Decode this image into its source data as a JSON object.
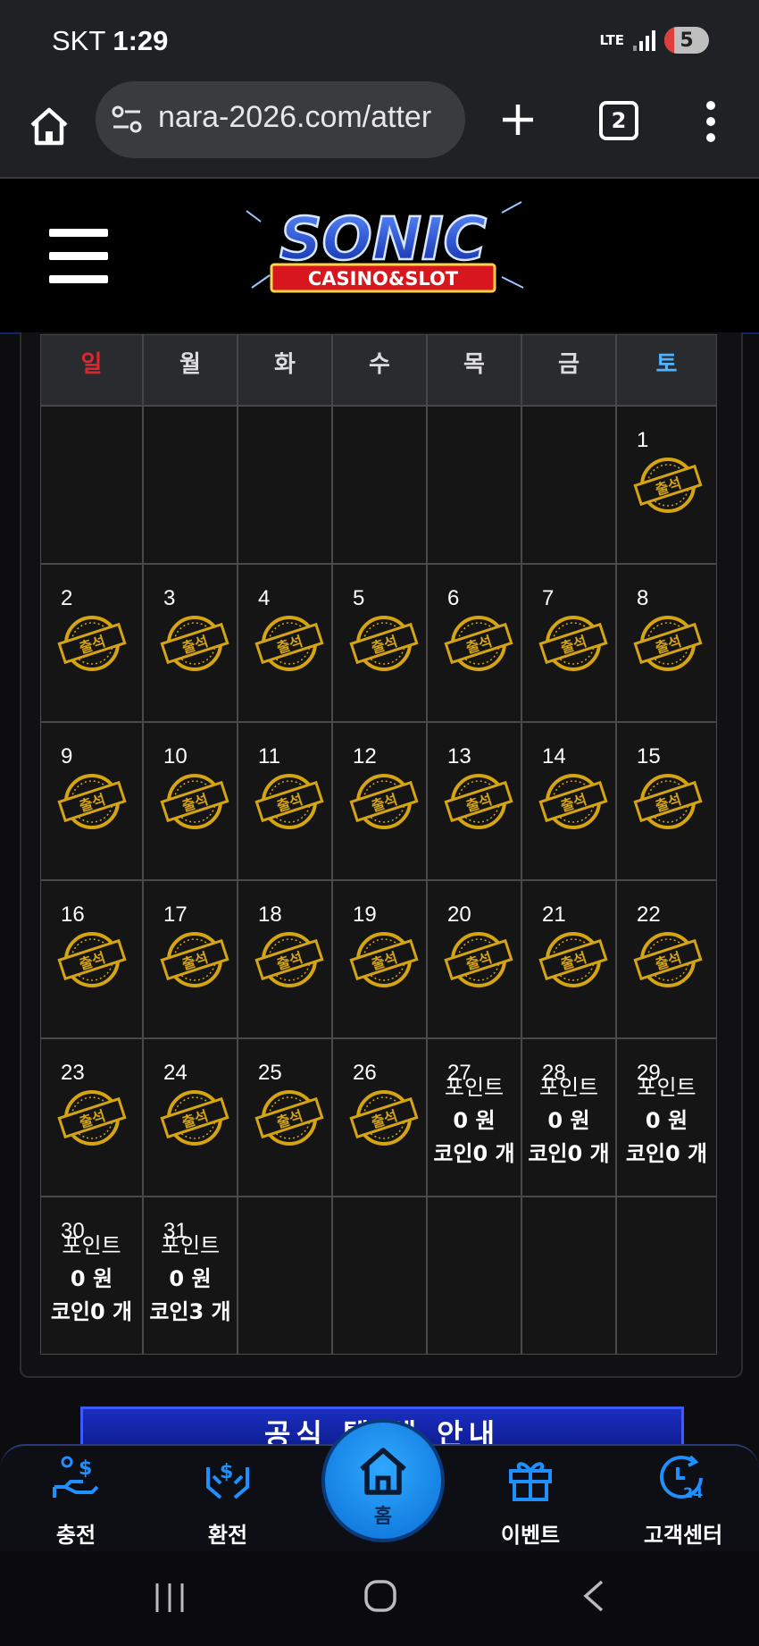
{
  "status_bar": {
    "carrier": "SKT",
    "time": "1:29",
    "network": "LTE",
    "battery": "5"
  },
  "browser": {
    "url": "nara-2026.com/atter",
    "tab_count": "2"
  },
  "site": {
    "brand": "SONIC",
    "brand_sub": "CASINO&SLOT"
  },
  "calendar": {
    "weekdays": [
      "일",
      "월",
      "화",
      "수",
      "목",
      "금",
      "토"
    ],
    "weekday_colors": [
      "#e0262c",
      "#dddddd",
      "#dddddd",
      "#dddddd",
      "#dddddd",
      "#dddddd",
      "#4fb3ff"
    ],
    "stamp_label": "출석",
    "weeks": [
      [
        null,
        null,
        null,
        null,
        null,
        null,
        {
          "day": "1",
          "stamp": true
        }
      ],
      [
        {
          "day": "2",
          "stamp": true
        },
        {
          "day": "3",
          "stamp": true
        },
        {
          "day": "4",
          "stamp": true
        },
        {
          "day": "5",
          "stamp": true
        },
        {
          "day": "6",
          "stamp": true
        },
        {
          "day": "7",
          "stamp": true
        },
        {
          "day": "8",
          "stamp": true
        }
      ],
      [
        {
          "day": "9",
          "stamp": true
        },
        {
          "day": "10",
          "stamp": true
        },
        {
          "day": "11",
          "stamp": true
        },
        {
          "day": "12",
          "stamp": true
        },
        {
          "day": "13",
          "stamp": true
        },
        {
          "day": "14",
          "stamp": true
        },
        {
          "day": "15",
          "stamp": true
        }
      ],
      [
        {
          "day": "16",
          "stamp": true
        },
        {
          "day": "17",
          "stamp": true
        },
        {
          "day": "18",
          "stamp": true
        },
        {
          "day": "19",
          "stamp": true
        },
        {
          "day": "20",
          "stamp": true
        },
        {
          "day": "21",
          "stamp": true
        },
        {
          "day": "22",
          "stamp": true
        }
      ],
      [
        {
          "day": "23",
          "stamp": true
        },
        {
          "day": "24",
          "stamp": true
        },
        {
          "day": "25",
          "stamp": true
        },
        {
          "day": "26",
          "stamp": true
        },
        {
          "day": "27",
          "points_label": "포인트",
          "points": "0 원",
          "coins": "코인0 개"
        },
        {
          "day": "28",
          "points_label": "포인트",
          "points": "0 원",
          "coins": "코인0 개"
        },
        {
          "day": "29",
          "points_label": "포인트",
          "points": "0 원",
          "coins": "코인0 개"
        }
      ],
      [
        {
          "day": "30",
          "points_label": "포인트",
          "points": "0 원",
          "coins": "코인0 개"
        },
        {
          "day": "31",
          "points_label": "포인트",
          "points": "0 원",
          "coins": "코인3 개"
        },
        null,
        null,
        null,
        null,
        null
      ]
    ]
  },
  "banner": {
    "text": "공식 텔 채 안내"
  },
  "bottom_nav": {
    "charge": "충전",
    "exchange": "환전",
    "home": "홈",
    "event": "이벤트",
    "support": "고객센터"
  },
  "colors": {
    "gold": "#d4a412",
    "accent_blue": "#1e90ff",
    "brand_blue": "#1a2dbf"
  }
}
